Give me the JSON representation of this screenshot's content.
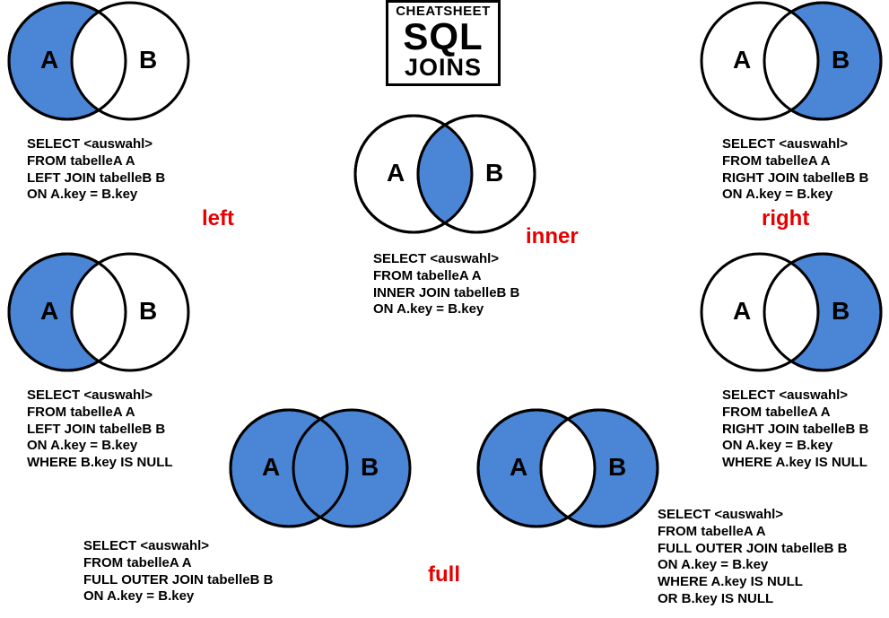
{
  "logo": {
    "line1": "CHEATSHEET",
    "line2": "SQL",
    "line3": "JOINS"
  },
  "labels": {
    "left": "left",
    "right": "right",
    "inner": "inner",
    "full": "full"
  },
  "joins": {
    "left": "SELECT <auswahl>\nFROM tabelleA A\nLEFT JOIN tabelleB B\nON A.key = B.key",
    "right": "SELECT <auswahl>\nFROM tabelleA A\nRIGHT JOIN tabelleB B\nON A.key = B.key",
    "inner": "SELECT <auswahl>\nFROM tabelleA A\nINNER JOIN tabelleB B\nON A.key = B.key",
    "left_excl": "SELECT <auswahl>\nFROM tabelleA A\nLEFT JOIN tabelleB B\nON A.key = B.key\nWHERE B.key IS NULL",
    "right_excl": "SELECT <auswahl>\nFROM tabelleA A\nRIGHT JOIN tabelleB B\nON A.key = B.key\nWHERE A.key IS NULL",
    "full": "SELECT <auswahl>\nFROM tabelleA A\nFULL OUTER JOIN tabelleB B\nON A.key = B.key",
    "full_excl": "SELECT <auswahl>\nFROM tabelleA A\nFULL OUTER JOIN tabelleB B\nON A.key = B.key\nWHERE A.key IS NULL\nOR B.key IS NULL"
  },
  "circle_labels": {
    "A": "A",
    "B": "B"
  },
  "colors": {
    "fill": "#4b86d6",
    "empty": "#ffffff",
    "stroke": "#000000"
  }
}
